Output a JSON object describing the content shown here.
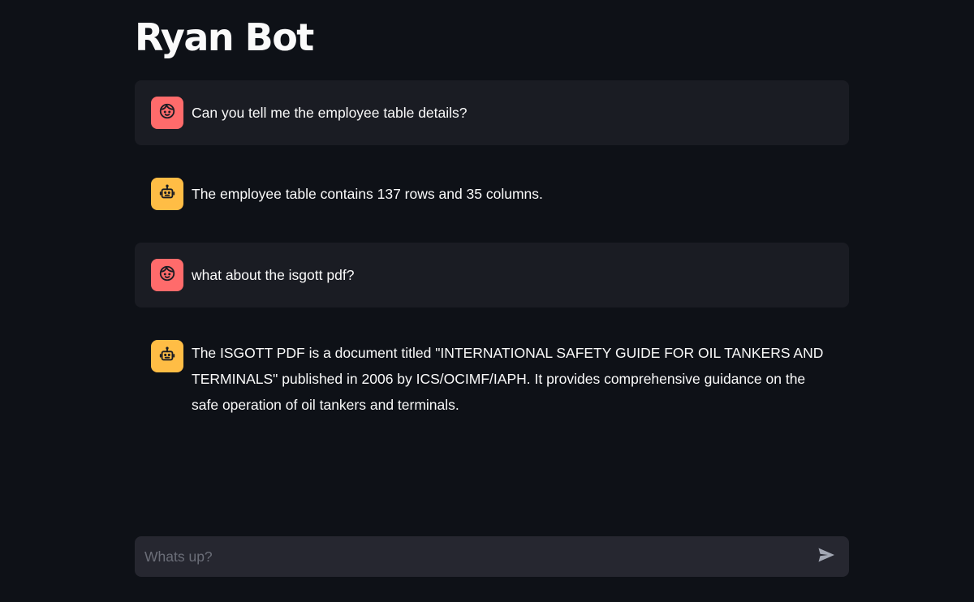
{
  "app": {
    "title": "Ryan Bot"
  },
  "colors": {
    "background": "#0e1117",
    "user_message_bg": "#1a1c23",
    "user_avatar": "#ff6b6b",
    "assistant_avatar": "#ffbd45",
    "input_bg": "#262730"
  },
  "messages": [
    {
      "role": "user",
      "avatar_icon": "user-face-icon",
      "text": "Can you tell me the employee table details?"
    },
    {
      "role": "assistant",
      "avatar_icon": "robot-icon",
      "text": "The employee table contains 137 rows and 35 columns."
    },
    {
      "role": "user",
      "avatar_icon": "user-face-icon",
      "text": "what about the isgott pdf?"
    },
    {
      "role": "assistant",
      "avatar_icon": "robot-icon",
      "text": "The ISGOTT PDF is a document titled \"INTERNATIONAL SAFETY GUIDE FOR OIL TANKERS AND TERMINALS\" published in 2006 by ICS/OCIMF/IAPH. It provides comprehensive guidance on the safe operation of oil tankers and terminals."
    }
  ],
  "chat_input": {
    "placeholder": "Whats up?",
    "value": "",
    "send_icon": "send-icon"
  }
}
